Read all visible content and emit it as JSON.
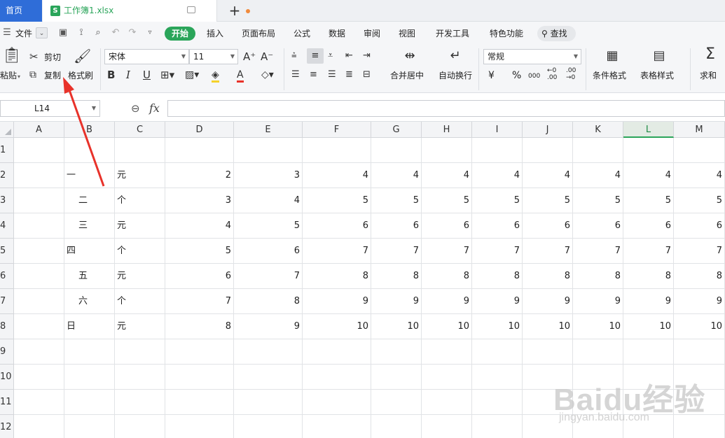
{
  "tabbar": {
    "home_label": "首页",
    "file_icon_letter": "S",
    "file_name": "工作簿1.xlsx",
    "new_tab_label": "+"
  },
  "menubar": {
    "file_menu": "文件",
    "tabs": [
      "开始",
      "插入",
      "页面布局",
      "公式",
      "数据",
      "审阅",
      "视图",
      "开发工具",
      "特色功能"
    ],
    "search_label": "查找"
  },
  "ribbon": {
    "paste": "粘贴",
    "cut": "剪切",
    "copy": "复制",
    "format_painter": "格式刷",
    "font_name": "宋体",
    "font_size": "11",
    "merge_center": "合并居中",
    "wrap_text": "自动换行",
    "number_format": "常规",
    "currency_symbol": "¥",
    "percent_symbol": "%",
    "thousands_symbol": "000",
    "decimal_inc": "←0 .00",
    "decimal_dec": ".00 →0",
    "conditional_format": "条件格式",
    "table_style": "表格样式",
    "sum": "求和"
  },
  "formula_bar": {
    "cell_ref": "L14",
    "fx_label": "fx",
    "value": ""
  },
  "sheet": {
    "columns": [
      "A",
      "B",
      "C",
      "D",
      "E",
      "F",
      "G",
      "H",
      "I",
      "J",
      "K",
      "L",
      "M"
    ],
    "selected_column": "L",
    "row_labels": [
      "1",
      "2",
      "3",
      "4",
      "5",
      "6",
      "7",
      "8",
      "9",
      "10",
      "11",
      "12"
    ],
    "rows": [
      [
        "",
        "",
        "",
        "",
        "",
        "",
        "",
        "",
        "",
        "",
        "",
        "",
        ""
      ],
      [
        "",
        "一",
        "元",
        "2",
        "3",
        "4",
        "4",
        "4",
        "4",
        "4",
        "4",
        "4",
        "4"
      ],
      [
        "",
        "  二",
        "个",
        "3",
        "4",
        "5",
        "5",
        "5",
        "5",
        "5",
        "5",
        "5",
        "5"
      ],
      [
        "",
        "  三",
        "元",
        "4",
        "5",
        "6",
        "6",
        "6",
        "6",
        "6",
        "6",
        "6",
        "6"
      ],
      [
        "",
        "四",
        "个",
        "5",
        "6",
        "7",
        "7",
        "7",
        "7",
        "7",
        "7",
        "7",
        "7"
      ],
      [
        "",
        "  五",
        "元",
        "6",
        "7",
        "8",
        "8",
        "8",
        "8",
        "8",
        "8",
        "8",
        "8"
      ],
      [
        "",
        "  六",
        "个",
        "7",
        "8",
        "9",
        "9",
        "9",
        "9",
        "9",
        "9",
        "9",
        "9"
      ],
      [
        "",
        "日",
        "元",
        "8",
        "9",
        "10",
        "10",
        "10",
        "10",
        "10",
        "10",
        "10",
        "10"
      ],
      [
        "",
        "",
        "",
        "",
        "",
        "",
        "",
        "",
        "",
        "",
        "",
        "",
        ""
      ],
      [
        "",
        "",
        "",
        "",
        "",
        "",
        "",
        "",
        "",
        "",
        "",
        "",
        ""
      ],
      [
        "",
        "",
        "",
        "",
        "",
        "",
        "",
        "",
        "",
        "",
        "",
        "",
        ""
      ],
      [
        "",
        "",
        "",
        "",
        "",
        "",
        "",
        "",
        "",
        "",
        "",
        "",
        ""
      ]
    ]
  },
  "watermark": {
    "brand": "Baidu经验",
    "url": "jingyan.baidu.com"
  },
  "colors": {
    "accent_green": "#2aa55a",
    "home_blue": "#2f6dd8",
    "annotation_red": "#e8322a"
  }
}
